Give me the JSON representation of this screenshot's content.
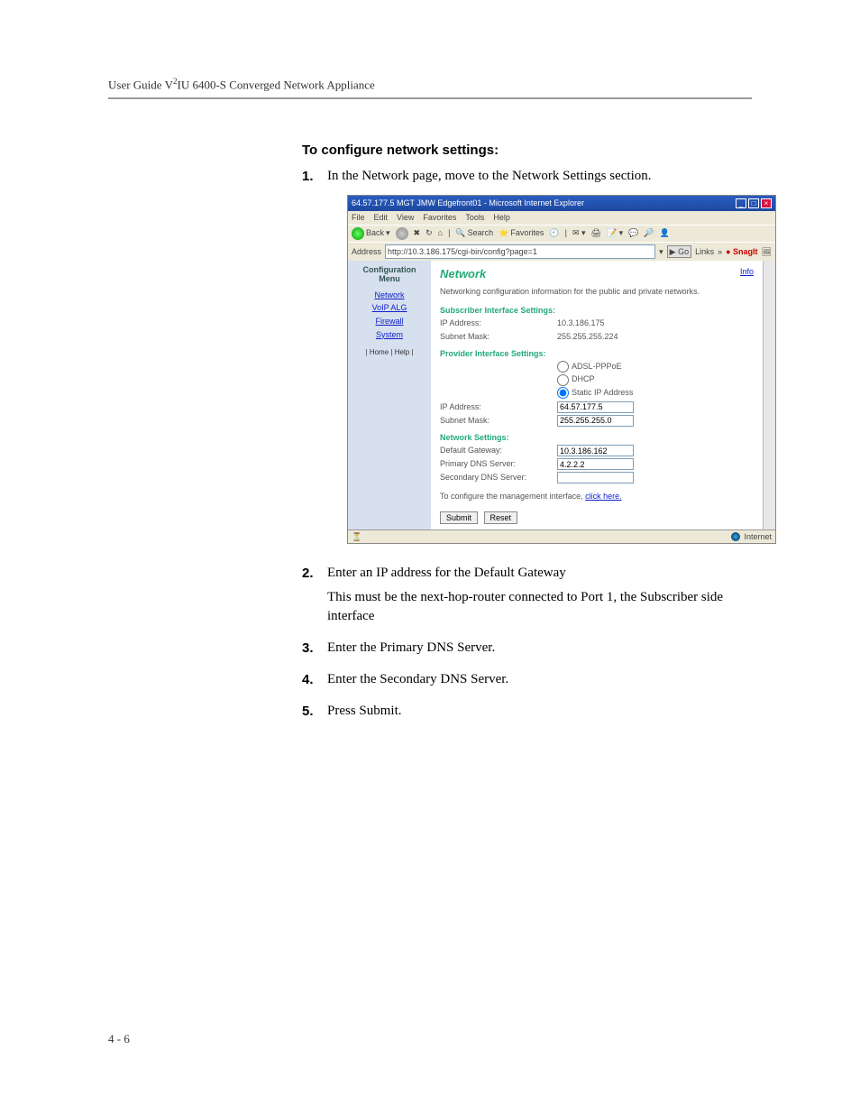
{
  "header": "User Guide V²IU 6400-S Converged Network Appliance",
  "section_title": "To configure network settings:",
  "steps": {
    "s1": {
      "num": "1.",
      "text": "In the Network page, move to the Network Settings section."
    },
    "s2": {
      "num": "2.",
      "text": "Enter an IP address for the Default Gateway",
      "note": "This must be the next-hop-router connected to Port 1, the Subscriber side interface"
    },
    "s3": {
      "num": "3.",
      "text": "Enter the Primary DNS Server."
    },
    "s4": {
      "num": "4.",
      "text": "Enter the Secondary DNS Server."
    },
    "s5": {
      "num": "5.",
      "text": "Press Submit."
    }
  },
  "footer_page": "4 - 6",
  "shot": {
    "title": "64.57.177.5 MGT JMW Edgefront01 - Microsoft Internet Explorer",
    "menu": {
      "file": "File",
      "edit": "Edit",
      "view": "View",
      "favorites": "Favorites",
      "tools": "Tools",
      "help": "Help"
    },
    "toolbar": {
      "back": "Back",
      "search": "Search",
      "favorites": "Favorites"
    },
    "address_label": "Address",
    "address_value": "http://10.3.186.175/cgi-bin/config?page=1",
    "go": "Go",
    "links": "Links",
    "snagit": "SnagIt",
    "sidebar": {
      "title1": "Configuration",
      "title2": "Menu",
      "items": {
        "network": "Network",
        "voip": "VoIP ALG",
        "firewall": "Firewall",
        "system": "System"
      },
      "home_help": "| Home | Help |"
    },
    "main": {
      "heading": "Network",
      "info": "Info",
      "desc": "Networking configuration information for the public and private networks.",
      "subscriber_h": "Subscriber Interface Settings:",
      "ip_label": "IP Address:",
      "mask_label": "Subnet Mask:",
      "sub_ip": "10.3.186.175",
      "sub_mask": "255.255.255.224",
      "provider_h": "Provider Interface Settings:",
      "radio": {
        "adsl": "ADSL-PPPoE",
        "dhcp": "DHCP",
        "static": "Static IP Address"
      },
      "prov_ip": "64.57.177.5",
      "prov_mask": "255.255.255.0",
      "net_h": "Network Settings:",
      "gw_label": "Default Gateway:",
      "gw_val": "10.3.186.162",
      "pdns_label": "Primary DNS Server:",
      "pdns_val": "4.2.2.2",
      "sdns_label": "Secondary DNS Server:",
      "sdns_val": "",
      "mgmt_text": "To configure the management interface, ",
      "mgmt_link": "click here.",
      "submit": "Submit",
      "reset": "Reset"
    },
    "status_zone": "Internet"
  }
}
